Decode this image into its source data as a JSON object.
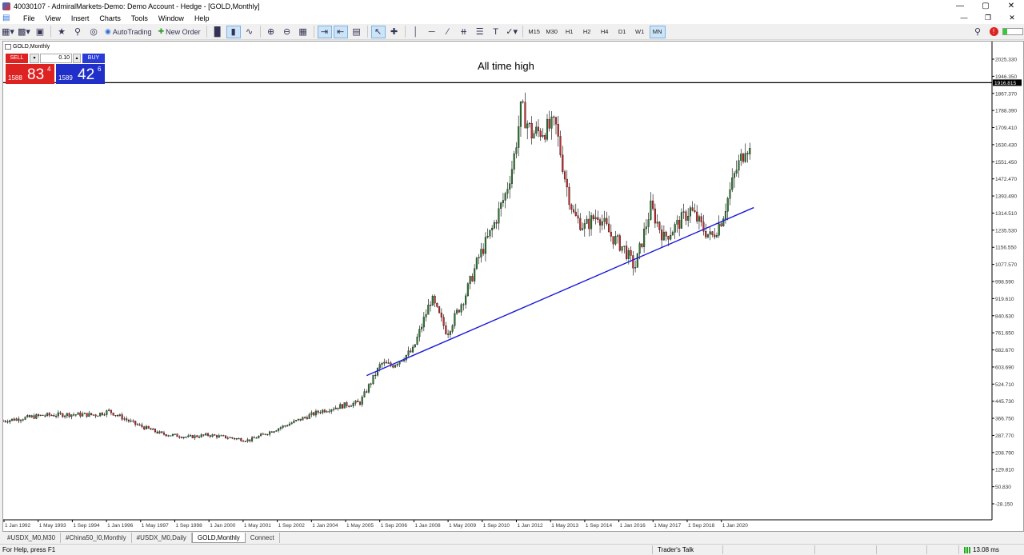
{
  "window": {
    "title": "40030107 - AdmiralMarkets-Demo: Demo Account - Hedge - [GOLD,Monthly]"
  },
  "menu": [
    "File",
    "View",
    "Insert",
    "Charts",
    "Tools",
    "Window",
    "Help"
  ],
  "toolbar": {
    "autotrading_label": "AutoTrading",
    "neworder_label": "New Order",
    "timeframes": [
      "M15",
      "M30",
      "H1",
      "H2",
      "H4",
      "D1",
      "W1",
      "MN"
    ],
    "active_timeframe": "MN"
  },
  "chart": {
    "symbol_label": "GOLD,Monthly",
    "annotation": "All time high",
    "current_price_label": "1916.815"
  },
  "oneclick": {
    "sell_label": "SELL",
    "buy_label": "BUY",
    "lot": "0.10",
    "sell_small": "1588",
    "sell_big": "83",
    "sell_sup": "4",
    "buy_small": "1589",
    "buy_big": "42",
    "buy_sup": "6"
  },
  "chart_data": {
    "type": "candlestick",
    "title": "",
    "y_ticks": [
      "2025.330",
      "1946.350",
      "1867.370",
      "1788.390",
      "1709.410",
      "1630.430",
      "1551.450",
      "1472.470",
      "1393.490",
      "1314.510",
      "1235.530",
      "1156.550",
      "1077.570",
      "998.590",
      "919.610",
      "840.630",
      "761.650",
      "682.670",
      "603.690",
      "524.710",
      "445.730",
      "366.750",
      "287.770",
      "208.790",
      "129.810",
      "50.830",
      "-28.150"
    ],
    "x_ticks": [
      "1 Jan 1992",
      "1 May 1993",
      "1 Sep 1994",
      "1 Jan 1996",
      "1 May 1997",
      "1 Sep 1998",
      "1 Jan 2000",
      "1 May 2001",
      "1 Sep 2002",
      "1 Jan 2004",
      "1 May 2005",
      "1 Sep 2006",
      "1 Jan 2008",
      "1 May 2009",
      "1 Sep 2010",
      "1 Jan 2012",
      "1 May 2013",
      "1 Sep 2014",
      "1 Jan 2016",
      "1 May 2017",
      "1 Sep 2018",
      "1 Jan 2020"
    ],
    "ylim": [
      -28.15,
      2025.33
    ],
    "x_range_years": [
      1992.0,
      2020.0
    ],
    "anchors": [
      [
        1992.0,
        355
      ],
      [
        1993.5,
        380
      ],
      [
        1994.5,
        385
      ],
      [
        1995.5,
        383
      ],
      [
        1996.0,
        400
      ],
      [
        1997.0,
        340
      ],
      [
        1998.0,
        295
      ],
      [
        1999.0,
        280
      ],
      [
        1999.75,
        290
      ],
      [
        2000.5,
        278
      ],
      [
        2001.3,
        265
      ],
      [
        2002.0,
        300
      ],
      [
        2003.0,
        350
      ],
      [
        2004.0,
        400
      ],
      [
        2005.0,
        430
      ],
      [
        2005.5,
        440
      ],
      [
        2006.3,
        620
      ],
      [
        2006.7,
        610
      ],
      [
        2007.5,
        680
      ],
      [
        2008.2,
        920
      ],
      [
        2008.8,
        760
      ],
      [
        2009.5,
        940
      ],
      [
        2010.0,
        1110
      ],
      [
        2010.5,
        1240
      ],
      [
        2011.0,
        1400
      ],
      [
        2011.3,
        1550
      ],
      [
        2011.6,
        1800
      ],
      [
        2012.0,
        1680
      ],
      [
        2012.5,
        1700
      ],
      [
        2012.9,
        1720
      ],
      [
        2013.3,
        1450
      ],
      [
        2013.6,
        1300
      ],
      [
        2014.0,
        1250
      ],
      [
        2014.5,
        1310
      ],
      [
        2015.0,
        1210
      ],
      [
        2015.5,
        1150
      ],
      [
        2015.9,
        1060
      ],
      [
        2016.5,
        1340
      ],
      [
        2017.0,
        1200
      ],
      [
        2017.5,
        1260
      ],
      [
        2018.0,
        1330
      ],
      [
        2018.5,
        1240
      ],
      [
        2018.8,
        1200
      ],
      [
        2019.2,
        1290
      ],
      [
        2019.7,
        1500
      ],
      [
        2020.0,
        1590
      ],
      [
        2020.1,
        1640
      ],
      [
        2020.25,
        1600
      ]
    ],
    "ath_price": 1916.815,
    "trendline": {
      "from": [
        2005.75,
        564
      ],
      "to": [
        2020.4,
        1340
      ]
    }
  },
  "tabs": [
    "#USDX_M0,M30",
    "#China50_I0,Monthly",
    "#USDX_M0,Daily",
    "GOLD,Monthly",
    "Connect"
  ],
  "active_tab": "GOLD,Monthly",
  "status": {
    "help": "For Help, press F1",
    "talk": "Trader's Talk",
    "ping": "13.08 ms"
  }
}
